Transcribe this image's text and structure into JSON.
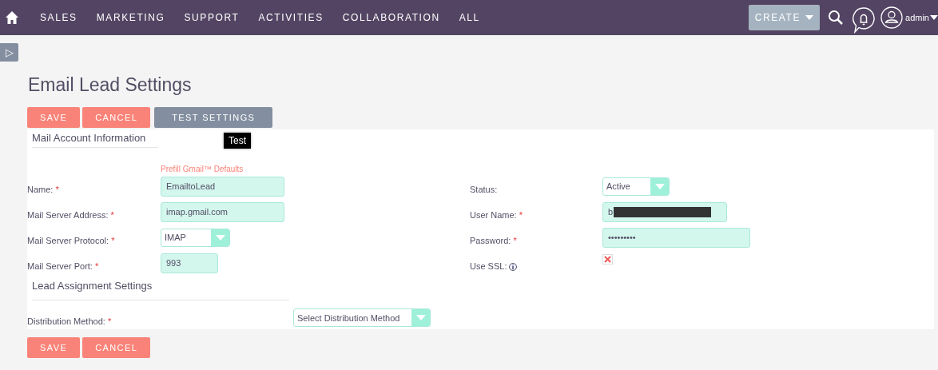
{
  "nav": {
    "items": [
      "SALES",
      "MARKETING",
      "SUPPORT",
      "ACTIVITIES",
      "COLLABORATION",
      "ALL"
    ],
    "create": "CREATE",
    "user": "admin"
  },
  "sidebar_toggle": "▷",
  "title": "Email Lead Settings",
  "top_buttons": [
    {
      "label": "SAVE",
      "kind": "primary"
    },
    {
      "label": "CANCEL",
      "kind": "primary"
    },
    {
      "label": "TEST SETTINGS",
      "kind": "secondary"
    }
  ],
  "tooltip": "Test",
  "mail_account": {
    "title": "Mail Account Information",
    "prefill_link": "Prefill Gmail™ Defaults",
    "left_fields": [
      {
        "label": "Name:",
        "required_mark": "*",
        "kind": "text",
        "value": "EmailtoLead"
      },
      {
        "label": "Mail Server Address:",
        "required_mark": "*",
        "kind": "text",
        "value": "imap.gmail.com"
      },
      {
        "label": "Mail Server Protocol:",
        "required_mark": "*",
        "kind": "select",
        "value": "IMAP"
      },
      {
        "label": "Mail Server Port:",
        "required_mark": "*",
        "kind": "text",
        "value": "993"
      }
    ],
    "right_fields": [
      {
        "label": "Status:",
        "kind": "select",
        "value": "Active"
      },
      {
        "label": "User Name:",
        "required_mark": "*",
        "kind": "text",
        "value": "b",
        "redacted": true
      },
      {
        "label": "Password:",
        "required_mark": "*",
        "kind": "text",
        "value": "•••••••••"
      },
      {
        "label": "Use SSL:",
        "kind": "checkbox",
        "checked": true,
        "info": true
      }
    ]
  },
  "lead_assignment": {
    "title": "Lead Assignment Settings",
    "fields": [
      {
        "label": "Distribution Method:",
        "required_mark": "*",
        "kind": "select",
        "value": "Select Distribution Method"
      }
    ]
  },
  "bottom_buttons": [
    {
      "label": "SAVE",
      "kind": "primary"
    },
    {
      "label": "CANCEL",
      "kind": "primary"
    }
  ]
}
